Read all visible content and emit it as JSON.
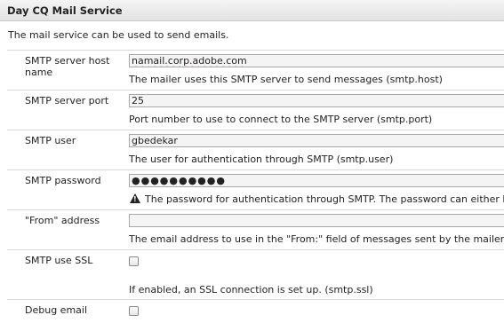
{
  "panel": {
    "title": "Day CQ Mail Service",
    "description": "The mail service can be used to send emails."
  },
  "fields": {
    "smtp_host": {
      "label": "SMTP server host name",
      "value": "namail.corp.adobe.com",
      "help": "The mailer uses this SMTP server to send messages (smtp.host)"
    },
    "smtp_port": {
      "label": "SMTP server port",
      "value": "25",
      "help": "Port number to use to connect to the SMTP server (smtp.port)"
    },
    "smtp_user": {
      "label": "SMTP user",
      "value": "gbedekar",
      "help": "The user for authentication through SMTP (smtp.user)"
    },
    "smtp_password": {
      "label": "SMTP password",
      "value": "●●●●●●●●●●",
      "help": "The password for authentication through SMTP. The password can either be",
      "help_icon": "warning-icon"
    },
    "from_address": {
      "label": "\"From\" address",
      "value": "",
      "help": "The email address to use in the \"From:\" field of messages sent by the mailer ("
    },
    "smtp_ssl": {
      "label": "SMTP use SSL",
      "checked": false,
      "help": "If enabled, an SSL connection is set up. (smtp.ssl)"
    },
    "debug_email": {
      "label": "Debug email",
      "checked": false
    }
  }
}
